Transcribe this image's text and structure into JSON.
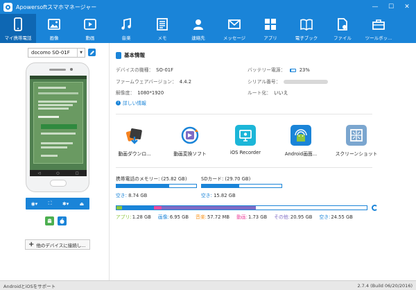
{
  "app": {
    "title": "Apowersoftスマホマネージャー"
  },
  "window": {
    "minimize": "—",
    "maximize": "☐",
    "close": "✕"
  },
  "toolbar": {
    "items": [
      {
        "label": "マイ携帯電話",
        "icon": "phone-icon"
      },
      {
        "label": "画像",
        "icon": "image-icon"
      },
      {
        "label": "動画",
        "icon": "video-icon"
      },
      {
        "label": "音楽",
        "icon": "music-icon"
      },
      {
        "label": "メモ",
        "icon": "memo-icon"
      },
      {
        "label": "連絡先",
        "icon": "contacts-icon"
      },
      {
        "label": "メッセージ",
        "icon": "message-icon"
      },
      {
        "label": "アプリ",
        "icon": "apps-icon"
      },
      {
        "label": "電子ブック",
        "icon": "ebook-icon"
      },
      {
        "label": "ファイル",
        "icon": "file-icon"
      },
      {
        "label": "ツールボッ...",
        "icon": "toolbox-icon"
      }
    ]
  },
  "left": {
    "device": "docomo SO-01F",
    "connect_button": "他のデバイスに接続し..."
  },
  "info": {
    "section_title": "基本情報",
    "model_label": "デバイスの機種：",
    "model_value": "SO-01F",
    "firmware_label": "ファームウェアバージョン：",
    "firmware_value": "4.4.2",
    "resolution_label": "解像度：",
    "resolution_value": "1080*1920",
    "battery_label": "バッテリー電源：",
    "battery_value": "23%",
    "battery_level": 0.23,
    "serial_label": "シリアル番号：",
    "root_label": "ルート化：",
    "root_value": "いいえ",
    "more_link": "詳しい情報"
  },
  "tools": [
    {
      "label": "動画ダウンロ...",
      "icon": "video-download-icon"
    },
    {
      "label": "動画変換ソフト",
      "icon": "video-convert-icon"
    },
    {
      "label": "iOS Recorder",
      "icon": "ios-recorder-icon"
    },
    {
      "label": "Android画面...",
      "icon": "android-screen-icon"
    },
    {
      "label": "スクリーンショット",
      "icon": "screenshot-icon"
    }
  ],
  "memory": {
    "phone_label": "携帯電話のメモリー: (25.82 GB)",
    "phone_free_key": "空き:",
    "phone_free_value": "8.74 GB",
    "phone_used_fraction": 0.66,
    "sd_label": "SDカード: (29.70 GB)",
    "sd_free_key": "空き:",
    "sd_free_value": "15.82 GB",
    "sd_used_fraction": 0.47
  },
  "usage": {
    "segments": [
      {
        "key": "アプリ:",
        "value": "1.28 GB",
        "color": "#8cc63f",
        "gb": 1.28
      },
      {
        "key": "画像:",
        "value": "6.95 GB",
        "color": "#1a84d8",
        "gb": 6.95
      },
      {
        "key": "音楽:",
        "value": "57.72 MB",
        "color": "#f7941d",
        "gb": 0.06
      },
      {
        "key": "動画:",
        "value": "1.73 GB",
        "color": "#ec4ba0",
        "gb": 1.73
      },
      {
        "key": "その他:",
        "value": "20.95 GB",
        "color": "#7e6bc4",
        "gb": 20.95
      },
      {
        "key": "空き:",
        "value": "24.55 GB",
        "color": "#ffffff",
        "gb": 24.55
      }
    ]
  },
  "status": {
    "left": "AndroidとiOSをサポート",
    "right": "2.7.4 (Build 06/20/2016)"
  }
}
